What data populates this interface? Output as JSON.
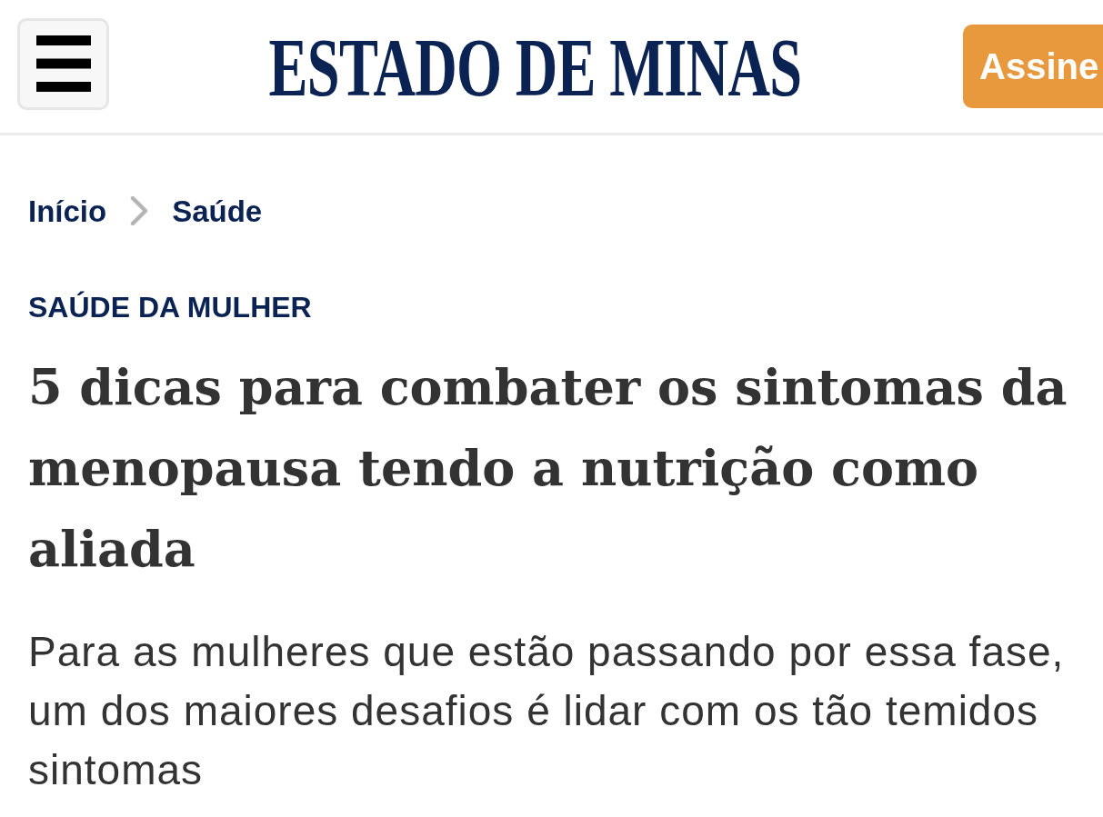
{
  "header": {
    "logo": "ESTADO DE MINAS",
    "subscribe_button": "Assine"
  },
  "breadcrumb": [
    {
      "label": "Início"
    },
    {
      "label": "Saúde"
    }
  ],
  "article": {
    "section": "SAÚDE DA MULHER",
    "headline": "5 dicas para combater os sintomas da menopausa tendo a nutrição como aliada",
    "subtitle": "Para as mulheres que estão passando por essa fase, um dos maiores desafios é lidar com os tão temidos sintomas"
  }
}
